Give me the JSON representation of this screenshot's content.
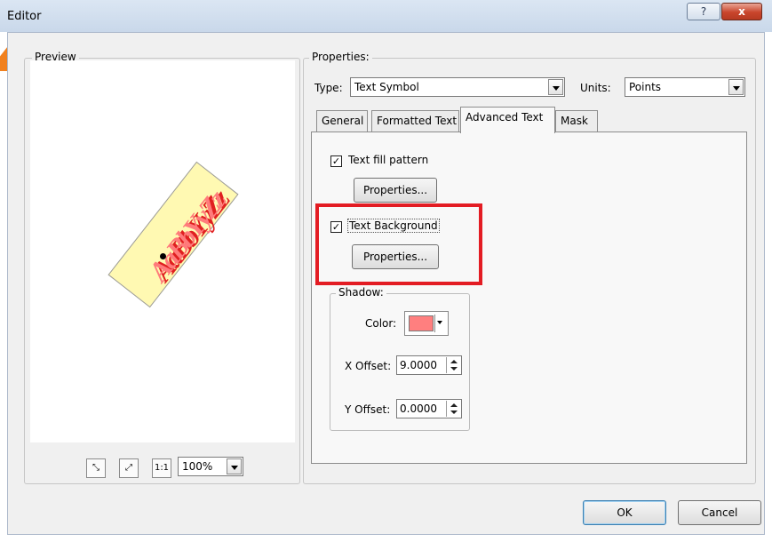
{
  "window": {
    "title": "Editor",
    "help_label": "?",
    "close_label": "x"
  },
  "preview": {
    "group_label": "Preview",
    "symbol_sample": "AaBbYyZz",
    "zoom_select_value": "100%",
    "zoom_buttons": [
      "fit-width",
      "fit-page",
      "1:1"
    ],
    "zoom_one_to_one": "1:1"
  },
  "properties": {
    "group_label": "Properties:",
    "type_label": "Type:",
    "type_value": "Text Symbol",
    "units_label": "Units:",
    "units_value": "Points"
  },
  "tabs": [
    {
      "label": "General",
      "active": false
    },
    {
      "label": "Formatted Text",
      "active": false
    },
    {
      "label": "Advanced Text",
      "active": true
    },
    {
      "label": "Mask",
      "active": false
    }
  ],
  "advanced": {
    "fill_pattern_label": "Text fill pattern",
    "fill_pattern_checked": true,
    "fill_props_button": "Properties...",
    "background_label": "Text Background",
    "background_checked": true,
    "background_props_button": "Properties...",
    "shadow_group_label": "Shadow:",
    "color_label": "Color:",
    "shadow_color": "#ff7f7f",
    "x_offset_label": "X Offset:",
    "x_offset_value": "9.0000",
    "y_offset_label": "Y Offset:",
    "y_offset_value": "0.0000"
  },
  "footer": {
    "ok_label": "OK",
    "cancel_label": "Cancel"
  },
  "colors": {
    "highlight": "#e31c23",
    "decoration": "#f07a12",
    "symbol_fill": "#fff9b2"
  }
}
